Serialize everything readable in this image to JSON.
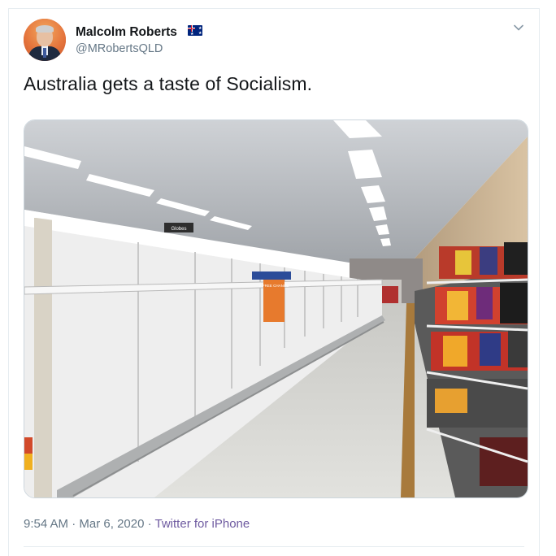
{
  "tweet": {
    "author_name": "Malcolm Roberts",
    "author_handle": "@MRobertsQLD",
    "text": "Australia gets a taste of Socialism.",
    "time": "9:54 AM",
    "separator": "·",
    "date": "Mar 6, 2020",
    "source": "Twitter for iPhone",
    "photo_sign": "Globes",
    "photo_poster": "A FREE CHANCE"
  },
  "icons": {
    "flag": "australia-flag-icon",
    "caret": "chevron-down-icon"
  },
  "colors": {
    "name": "#14171a",
    "secondary": "#657786",
    "source_link": "#6e5aa0",
    "border": "#e6ecf0"
  }
}
